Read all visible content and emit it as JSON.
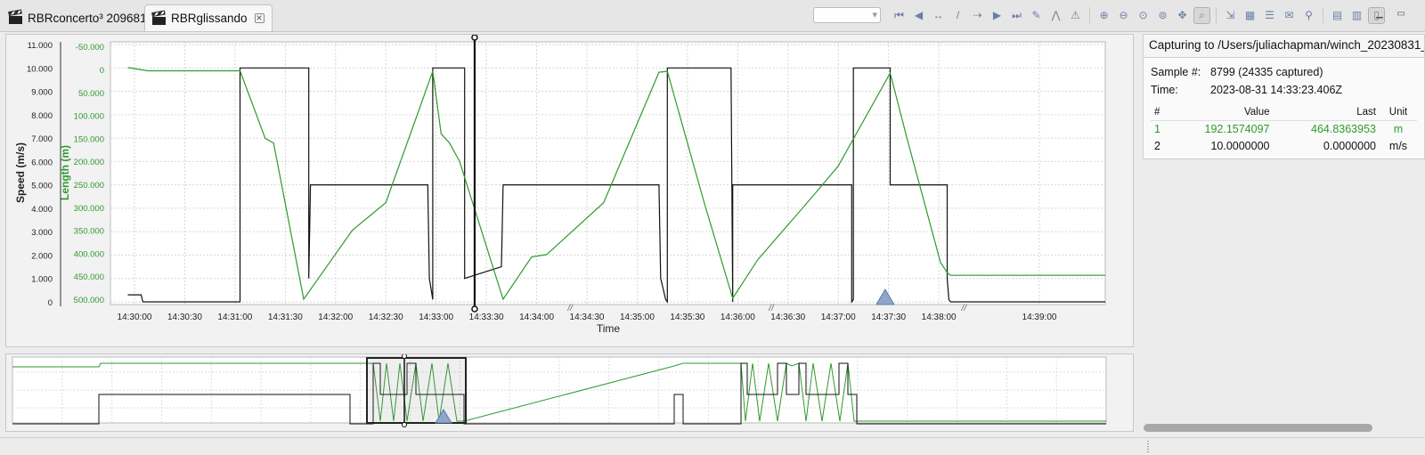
{
  "tabs": [
    {
      "label": "RBRconcerto³ 209681",
      "active": false
    },
    {
      "label": "RBRglissando",
      "active": true
    }
  ],
  "toolbar_icons": [
    "first-icon",
    "prev-icon",
    "zoom-x-icon",
    "slash-icon",
    "zoom-y-icon",
    "next-icon",
    "last-icon",
    "magic-wand-icon",
    "peaks-icon",
    "warning-icon",
    "zoom-in-icon",
    "zoom-out-icon",
    "zoom-fit-icon",
    "zoom-reset-icon",
    "zoom-all-icon",
    "auto-zoom-icon",
    "export-icon",
    "layout-icon",
    "list-icon",
    "email-icon",
    "pin-icon",
    "panel-icon",
    "split-icon",
    "window-icon"
  ],
  "side_panel": {
    "title": "Capturing to /Users/juliachapman/winch_20230831_",
    "sample_label": "Sample #:",
    "sample_value": "8799 (24335 captured)",
    "time_label": "Time:",
    "time_value": "2023-08-31 14:33:23.406Z",
    "columns": [
      "#",
      "Value",
      "Last",
      "Unit"
    ],
    "rows": [
      {
        "num": "1",
        "value": "192.1574097",
        "last": "464.8363953",
        "unit": "m",
        "color": "#2e9a2e"
      },
      {
        "num": "2",
        "value": "10.0000000",
        "last": "0.0000000",
        "unit": "m/s",
        "color": "#111111"
      }
    ]
  },
  "chart_data": {
    "type": "line",
    "xlabel": "Time",
    "x_ticks": [
      "14:30:00",
      "14:30:30",
      "14:31:00",
      "14:31:30",
      "14:32:00",
      "14:32:30",
      "14:33:00",
      "14:33:30",
      "14:34:00",
      "14:34:30",
      "14:35:00",
      "14:35:30",
      "14:36:00",
      "14:36:30",
      "14:37:00",
      "14:37:30",
      "14:38:00",
      "14:39:00"
    ],
    "y_left": {
      "label": "Speed (m/s)",
      "ticks": [
        "11.000",
        "10.000",
        "9.000",
        "8.000",
        "7.000",
        "6.000",
        "5.000",
        "4.000",
        "3.000",
        "2.000",
        "1.000",
        "0"
      ],
      "range": [
        0,
        11
      ]
    },
    "y_right": {
      "label": "Length (m)",
      "ticks": [
        "-50.000",
        "0",
        "50.000",
        "100.000",
        "150.000",
        "200.000",
        "250.000",
        "300.000",
        "350.000",
        "400.000",
        "450.000",
        "500.000"
      ],
      "range": [
        -50,
        500
      ],
      "inverted": true,
      "color": "#2e9a2e"
    },
    "cursor_time": "14:33:23",
    "series": [
      {
        "name": "Speed (m/s)",
        "color": "#111111",
        "x": [
          "14:29:56",
          "14:30:04",
          "14:30:05",
          "14:31:03",
          "14:31:03",
          "14:31:44",
          "14:31:44",
          "14:31:45",
          "14:31:45",
          "14:32:55",
          "14:32:56",
          "14:32:58",
          "14:32:58",
          "14:33:17",
          "14:33:17",
          "14:33:39",
          "14:33:40",
          "14:33:40",
          "14:35:13",
          "14:35:14",
          "14:35:17",
          "14:35:18",
          "14:35:18",
          "14:35:56",
          "14:35:57",
          "14:35:57",
          "14:37:08",
          "14:37:08",
          "14:37:09",
          "14:37:09",
          "14:37:31",
          "14:37:31",
          "14:38:05",
          "14:38:05",
          "14:38:06",
          "14:38:07",
          "14:39:40"
        ],
        "y": [
          0.3,
          0.3,
          0.0,
          0.0,
          10.0,
          10.0,
          1.0,
          5.0,
          5.0,
          5.0,
          1.0,
          0.1,
          10.0,
          10.0,
          1.0,
          1.5,
          5.0,
          5.0,
          5.0,
          1.0,
          0.1,
          0.0,
          10.0,
          10.0,
          0.0,
          5.0,
          5.0,
          0.0,
          0.1,
          10.0,
          10.0,
          5.0,
          5.0,
          1.0,
          0.1,
          0.0,
          0.0
        ]
      },
      {
        "name": "Length (m)",
        "color": "#2e9a2e",
        "x": [
          "14:29:56",
          "14:30:08",
          "14:31:03",
          "14:31:18",
          "14:31:23",
          "14:31:41",
          "14:32:10",
          "14:32:30",
          "14:32:58",
          "14:33:03",
          "14:33:08",
          "14:33:14",
          "14:33:40",
          "14:33:57",
          "14:34:06",
          "14:34:40",
          "14:35:13",
          "14:35:18",
          "14:35:40",
          "14:35:57",
          "14:36:12",
          "14:36:45",
          "14:37:00",
          "14:37:31",
          "14:37:41",
          "14:38:01",
          "14:38:05",
          "14:38:07",
          "14:39:40"
        ],
        "y": [
          -4,
          3,
          3,
          150,
          160,
          500,
          350,
          290,
          4,
          140,
          160,
          200,
          500,
          408,
          403,
          290,
          6,
          4,
          290,
          498,
          414,
          275,
          210,
          8,
          150,
          420,
          442,
          448,
          448
        ]
      }
    ]
  },
  "overview": {
    "warning_marker": "warning-icon"
  }
}
